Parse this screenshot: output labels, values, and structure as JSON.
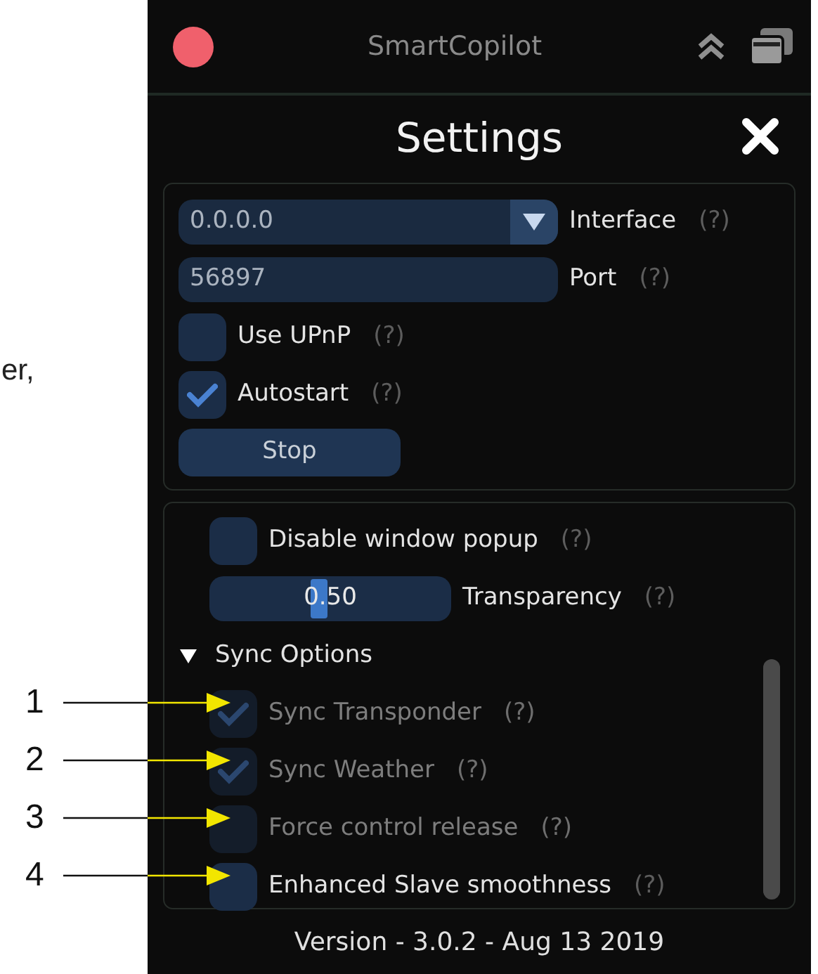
{
  "note_text": "er,",
  "annotations": [
    {
      "label": "1"
    },
    {
      "label": "2"
    },
    {
      "label": "3"
    },
    {
      "label": "4"
    }
  ],
  "window": {
    "title": "SmartCopilot",
    "heading": "Settings"
  },
  "connection": {
    "interface": {
      "value": "0.0.0.0",
      "label": "Interface",
      "help": "(?)"
    },
    "port": {
      "value": "56897",
      "label": "Port",
      "help": "(?)"
    },
    "options": [
      {
        "label": "Use UPnP",
        "help": "(?)",
        "checked": false
      },
      {
        "label": "Autostart",
        "help": "(?)",
        "checked": true
      }
    ],
    "button": "Stop"
  },
  "settings": [
    {
      "kind": "checkbox",
      "label": "Disable window popup",
      "help": "(?)",
      "checked": false,
      "disabled": false
    },
    {
      "kind": "slider",
      "reading": "0.50",
      "level": 0.45,
      "label": "Transparency",
      "help": "(?)"
    },
    {
      "kind": "section",
      "label": "Sync Options",
      "expanded": true,
      "children": [
        {
          "kind": "checkbox",
          "label": "Sync Transponder",
          "help": "(?)",
          "checked": true,
          "disabled": true
        },
        {
          "kind": "checkbox",
          "label": "Sync Weather",
          "help": "(?)",
          "checked": true,
          "disabled": true
        },
        {
          "kind": "checkbox",
          "label": "Force control release",
          "help": "(?)",
          "checked": false,
          "disabled": true
        },
        {
          "kind": "checkbox",
          "label": "Enhanced Slave smoothness",
          "help": "(?)",
          "checked": false,
          "disabled": false
        }
      ]
    }
  ],
  "version": "Version - 3.0.2 - Aug 13 2019"
}
